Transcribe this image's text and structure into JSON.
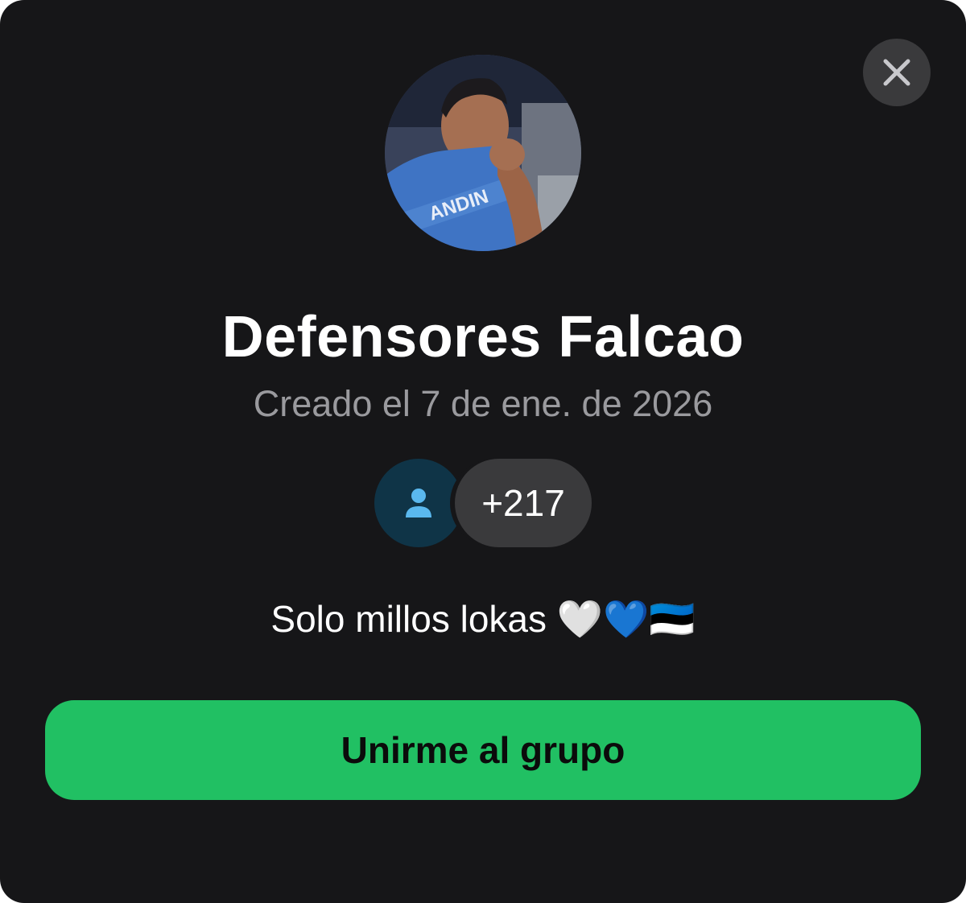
{
  "dialog": {
    "close_icon": "close-icon",
    "avatar_icon": "group-photo",
    "title": "Defensores Falcao",
    "created": "Creado el 7 de ene. de 2026",
    "members": {
      "icon": "person-icon",
      "count": "+217"
    },
    "description": "Solo millos lokas 🤍💙🇪🇪",
    "join_button": "Unirme al grupo",
    "colors": {
      "background": "#161618",
      "button": "#21c063",
      "secondary_text": "#9a9a9e",
      "member_icon": "#5ab8ee"
    }
  }
}
